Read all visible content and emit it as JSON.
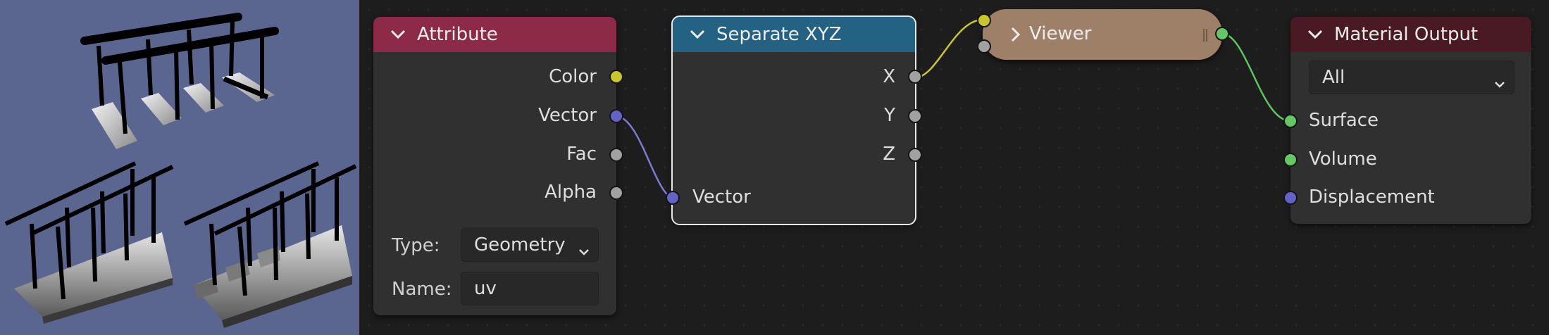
{
  "nodes": {
    "attribute": {
      "title": "Attribute",
      "outputs": [
        "Color",
        "Vector",
        "Fac",
        "Alpha"
      ],
      "type_label": "Type:",
      "type_value": "Geometry",
      "name_label": "Name:",
      "name_value": "uv"
    },
    "separate_xyz": {
      "title": "Separate XYZ",
      "outputs": [
        "X",
        "Y",
        "Z"
      ],
      "input": "Vector"
    },
    "viewer": {
      "title": "Viewer"
    },
    "material_output": {
      "title": "Material Output",
      "target_value": "All",
      "inputs": [
        "Surface",
        "Volume",
        "Displacement"
      ]
    }
  },
  "colors": {
    "attribute_header": "#8d2a48",
    "separate_header": "#246283",
    "viewer_body": "#9e8068",
    "output_header": "#4a1a24",
    "socket_color": "#c7c729",
    "socket_vector": "#6363c7",
    "socket_float": "#a1a1a1",
    "socket_shader": "#63c763",
    "viewport_bg": "#5a6590"
  }
}
